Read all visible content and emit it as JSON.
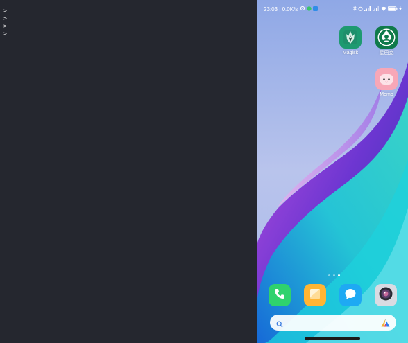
{
  "terminal": {
    "lines": [
      ">",
      ">",
      ">",
      ">"
    ]
  },
  "phone": {
    "status": {
      "time": "23:03",
      "separator": "|",
      "network_speed": "0.0K/s",
      "battery_icon": "battery-icon"
    },
    "apps": [
      {
        "label": "Magisk",
        "icon": "magisk-icon",
        "color": "#1e9a70"
      },
      {
        "label": "星巴克",
        "icon": "starbucks-icon",
        "color": "#0f7a4a"
      },
      {
        "label": "Momo",
        "icon": "momo-icon",
        "color": "#f7a7b7"
      }
    ],
    "page_indicator": {
      "pages": 3,
      "active": 3
    },
    "dock": [
      {
        "name": "phone",
        "icon": "phone-icon",
        "color": "#2fd26d"
      },
      {
        "name": "notes",
        "icon": "notes-icon",
        "color": "#ffb533"
      },
      {
        "name": "messages",
        "icon": "messages-icon",
        "color": "#1ea9f3"
      },
      {
        "name": "camera",
        "icon": "camera-icon",
        "color": "#d9dbe2"
      }
    ],
    "search": {
      "icon": "search-icon",
      "assistant_icon": "assistant-icon"
    }
  }
}
